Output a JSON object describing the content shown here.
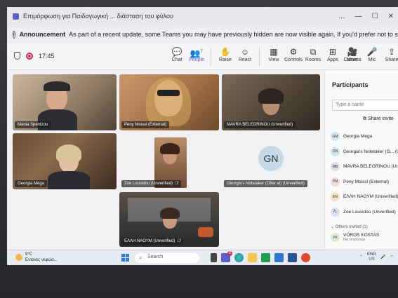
{
  "window": {
    "title": "Επιμόρφωση για Παιδαγωγική ... διάσταση του φύλου",
    "controls": [
      "…",
      "—",
      "☐",
      "✕"
    ]
  },
  "announcement": {
    "label": "Announcement",
    "text": "As part of a recent update, some Teams you may have previously hidden are now visible again. If you'd prefer not to see them, you can easily hide them from your"
  },
  "toolbar": {
    "timer": "17:45",
    "items": [
      {
        "label": "Chat",
        "glyph": "💬",
        "active": false
      },
      {
        "label": "People",
        "glyph": "👥",
        "badge": "7",
        "active": true
      },
      {
        "label": "Raise",
        "glyph": "✋",
        "active": false
      },
      {
        "label": "React",
        "glyph": "☺",
        "active": false
      },
      {
        "label": "View",
        "glyph": "▦",
        "active": false
      },
      {
        "label": "Controls",
        "glyph": "⚙",
        "active": false
      },
      {
        "label": "Rooms",
        "glyph": "⧉",
        "active": false
      },
      {
        "label": "Apps",
        "glyph": "⊞",
        "active": false
      },
      {
        "label": "More",
        "glyph": "…",
        "active": false
      }
    ],
    "right_items": [
      {
        "label": "Camera",
        "glyph": "🎥"
      },
      {
        "label": "Mic",
        "glyph": "🎤"
      },
      {
        "label": "Share",
        "glyph": "⇪"
      }
    ]
  },
  "tiles": [
    {
      "name": "Mania Spentzou",
      "muted": false
    },
    {
      "name": "Peny Moissi (External)",
      "muted": false
    },
    {
      "name": "MAVRA BELEGRINOU (Unverified)",
      "muted": false
    },
    {
      "name": "Georgia Mega",
      "muted": false
    },
    {
      "name": "Zoe Lousidou (Unverified)",
      "muted": true
    },
    {
      "name": "Georgia's Notetaker (Otter.ai) (Unverified)",
      "muted": false,
      "initials": "GN"
    },
    {
      "name": "ΕΛΛΗ ΝΑΟΥΜ (Unverified)",
      "muted": true
    }
  ],
  "participants": {
    "title": "Participants",
    "search_placeholder": "Type a name",
    "share_invite": "Share invite",
    "list": [
      {
        "initials": "GM",
        "name": "Georgia Mega",
        "color": "#d6e4ee"
      },
      {
        "initials": "GN",
        "name": "Georgia's Notetaker (O... (Unv",
        "color": "#cfe3e8"
      },
      {
        "initials": "MB",
        "name": "MAVRA BELEGRINOU (Unverifi",
        "color": "#e2dbe9"
      },
      {
        "initials": "PM",
        "name": "Peny Moissi (External)",
        "color": "#f0dcd6"
      },
      {
        "initials": "EN",
        "name": "ΕΛΛΗ ΝΑΟΥΜ (Unverified)",
        "color": "#f3e2c4"
      },
      {
        "initials": "ZL",
        "name": "Zoe Lousidou (Unverified)",
        "color": "#d9e2f0"
      }
    ],
    "others_label": "Others invited (1)",
    "others": [
      {
        "initials": "VK",
        "name": "VOROS KOSTAS",
        "status": "No response",
        "color": "#dfe8d6"
      }
    ]
  },
  "taskbar": {
    "temperature": "9°C",
    "weather_text": "Εντονες νεφώσ...",
    "search_placeholder": "Search",
    "teams_badge": "2",
    "lang": "ENG",
    "region": "US"
  }
}
